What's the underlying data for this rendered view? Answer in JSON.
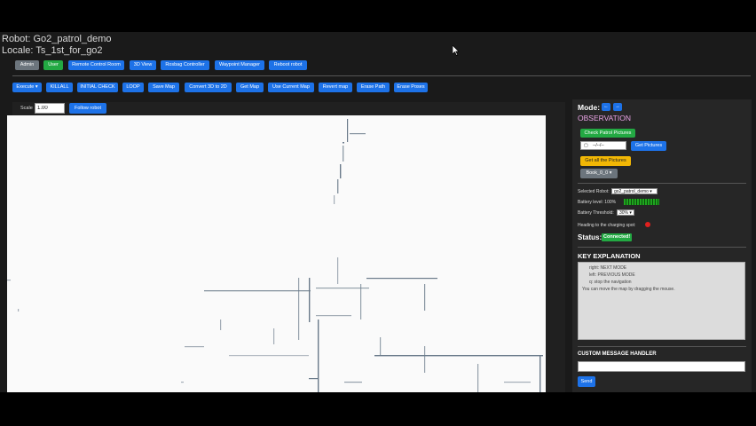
{
  "header": {
    "robot_line": "Robot: Go2_patrol_demo",
    "locale_line": "Locale: Ts_1st_for_go2"
  },
  "role_bar": {
    "admin": "Admin",
    "user": "User",
    "remote_control": "Remote Control Room",
    "view_3d": "3D View",
    "rosbag": "Rosbag Controller",
    "waypoint": "Waypoint Manager",
    "reboot": "Reboot robot"
  },
  "action_bar": {
    "execute": "Execute",
    "killall": "KILLALL",
    "initial_check": "INITIAL CHECK",
    "loop": "LOOP",
    "save_map": "Save Map",
    "convert": "Convert 3D to 2D",
    "get_map": "Get Map",
    "use_current": "Use Current Map",
    "revert": "Revert map",
    "erase_path": "Erase Path",
    "erase_poses": "Erase Poses"
  },
  "map": {
    "scale_label": "Scale",
    "scale_value": "1.00",
    "follow_robot": "Follow robot"
  },
  "panel": {
    "mode_label": "Mode:",
    "mode_prev": "←",
    "mode_next": "→",
    "mode_value": "OBSERVATION",
    "check_patrol": "Check Patrol Pictures",
    "date_value": "--/--/--",
    "get_pictures": "Get Pictures",
    "get_all": "Get all the Pictures",
    "book_select": "Book_0_0",
    "selected_robot_label": "Selected Robot:",
    "selected_robot_value": "go2_patrol_demo",
    "battery_label": "Battery level: 100%",
    "threshold_label": "Battery Threshold:",
    "threshold_value": "30%",
    "heading_label": "Heading to the charging spot:",
    "status_label": "Status:",
    "status_value": "Connected!",
    "key_title": "KEY EXPLANATION",
    "key_lines": [
      "right: NEXT MODE",
      "left: PREVIOUS MODE",
      "q: stop the navigation",
      "You can move the map by dragging the mouse."
    ],
    "custom_title": "CUSTOM MESSAGE HANDLER",
    "send": "Send"
  },
  "colors": {
    "primary": "#1d72e8",
    "success": "#23a943",
    "warning": "#f2b705",
    "mode_text": "#e9a3e4",
    "heading_dot": "#e0201e"
  }
}
